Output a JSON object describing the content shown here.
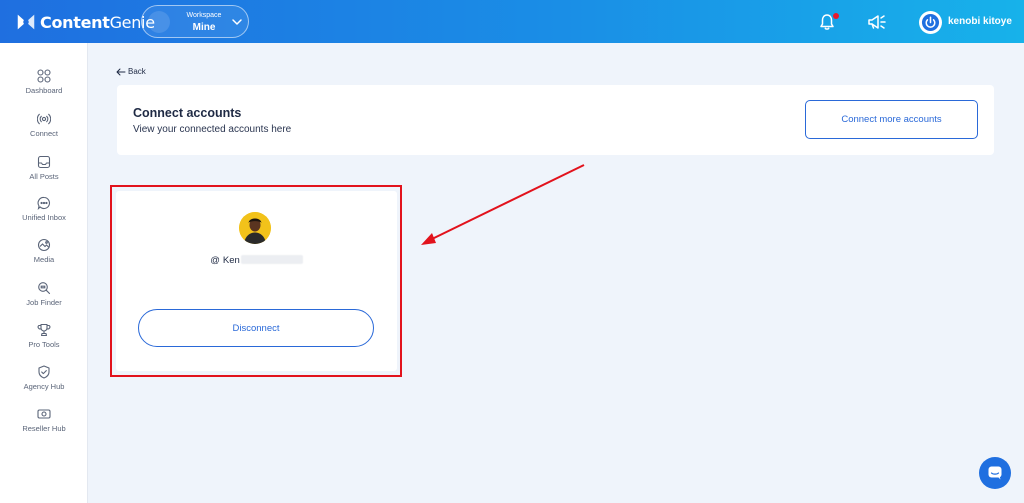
{
  "header": {
    "logo_bold": "Content",
    "logo_light": "Genie",
    "workspace": {
      "label": "Workspace",
      "value": "Mine"
    },
    "user_name": "kenobi kitoye",
    "icons": [
      "bell-icon",
      "megaphone-icon",
      "power-icon"
    ]
  },
  "sidebar": {
    "items": [
      {
        "label": "Dashboard",
        "icon": "dashboard-icon"
      },
      {
        "label": "Connect",
        "icon": "broadcast-icon"
      },
      {
        "label": "All Posts",
        "icon": "inbox-tray-icon"
      },
      {
        "label": "Unified Inbox",
        "icon": "chat-bubble-icon"
      },
      {
        "label": "Media",
        "icon": "media-icon"
      },
      {
        "label": "Job Finder",
        "icon": "job-search-icon"
      },
      {
        "label": "Pro Tools",
        "icon": "trophy-icon"
      },
      {
        "label": "Agency Hub",
        "icon": "shield-check-icon"
      },
      {
        "label": "Reseller Hub",
        "icon": "money-icon"
      }
    ]
  },
  "main": {
    "back_label": "Back",
    "title": "Connect accounts",
    "subtitle": "View your connected accounts here",
    "connect_more_label": "Connect more accounts",
    "account": {
      "at": "@",
      "handle_visible": "Ken",
      "disconnect_label": "Disconnect"
    }
  },
  "annotation": {
    "highlight_color": "#e2121c",
    "arrow_color": "#e2121c"
  },
  "colors": {
    "accent": "#2a69d8",
    "topbar_start": "#1f6fe0",
    "topbar_end": "#17b2ea",
    "page_bg": "#eff4fb"
  }
}
